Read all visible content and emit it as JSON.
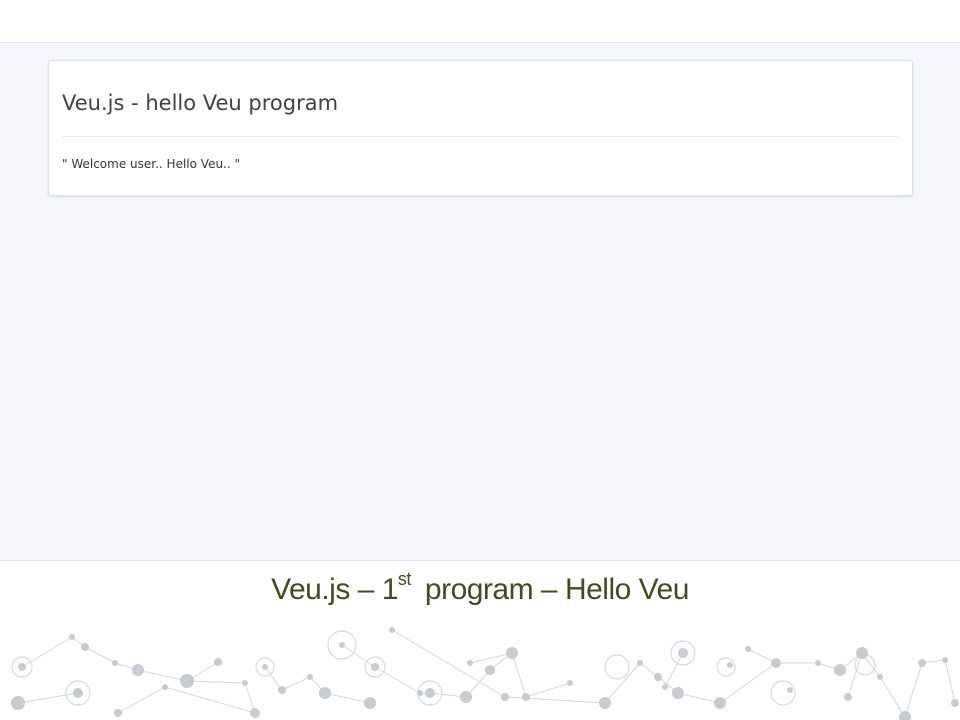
{
  "card": {
    "title": "Veu.js - hello Veu program",
    "body": "\" Welcome user.. Hello Veu.. \""
  },
  "caption": {
    "part1": "Veu.js – 1",
    "superscript": "st",
    "part2": "program – Hello Veu"
  },
  "colors": {
    "caption": "#3f4d22",
    "browser_background": "#f5f7fc",
    "network_dots": "#c6ccd2"
  },
  "decoration": {
    "icon": "network-pattern"
  }
}
